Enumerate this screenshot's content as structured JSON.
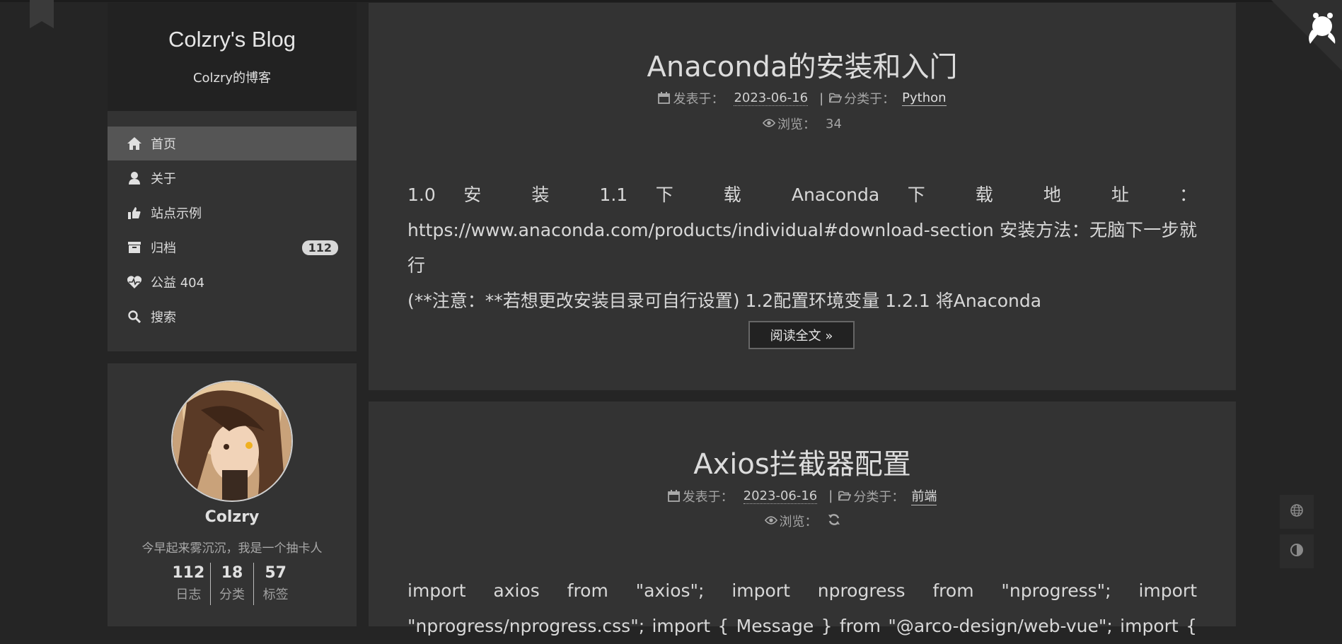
{
  "site": {
    "title": "Colzry's Blog",
    "subtitle": "Colzry的博客"
  },
  "menu": {
    "items": [
      {
        "label": "首页",
        "icon": "home-icon",
        "active": true
      },
      {
        "label": "关于",
        "icon": "user-icon"
      },
      {
        "label": "站点示例",
        "icon": "thumbs-up-icon"
      },
      {
        "label": "归档",
        "icon": "archive-icon",
        "badge": "112"
      },
      {
        "label": "公益 404",
        "icon": "heartbeat-icon"
      },
      {
        "label": "搜索",
        "icon": "search-icon"
      }
    ]
  },
  "profile": {
    "name": "Colzry",
    "description": "今早起来雾沉沉，我是一个抽卡人",
    "stats": [
      {
        "count": "112",
        "label": "日志"
      },
      {
        "count": "18",
        "label": "分类"
      },
      {
        "count": "57",
        "label": "标签"
      }
    ]
  },
  "posts": [
    {
      "title": "Anaconda的安装和入门",
      "posted_label": "发表于：",
      "date": "2023-06-16",
      "separator": "|",
      "category_label": "分类于：",
      "category": "Python",
      "views_label": "浏览：",
      "views": "34",
      "excerpt_lines": [
        "1.0 安 装  1.1 下 载  Anaconda 下 载 地 址 ：",
        "https://www.anaconda.com/products/individual#download-section 安装方法：无脑下一步就行",
        "(**注意：**若想更改安装目录可自行设置) 1.2配置环境变量 1.2.1 将Anaconda"
      ],
      "read_more": "阅读全文 »"
    },
    {
      "title": "Axios拦截器配置",
      "posted_label": "发表于：",
      "date": "2023-06-16",
      "separator": "|",
      "category_label": "分类于：",
      "category": "前端",
      "views_label": "浏览：",
      "excerpt_lines": [
        "import axios from \"axios\"; import nprogress from \"nprogress\"; import",
        "\"nprogress/nprogress.css\"; import { Message } from \"@arco-design/web-vue\"; import {"
      ]
    }
  ],
  "colors": {
    "background": "#252525",
    "panel": "#333333",
    "active_menu": "#555555"
  }
}
